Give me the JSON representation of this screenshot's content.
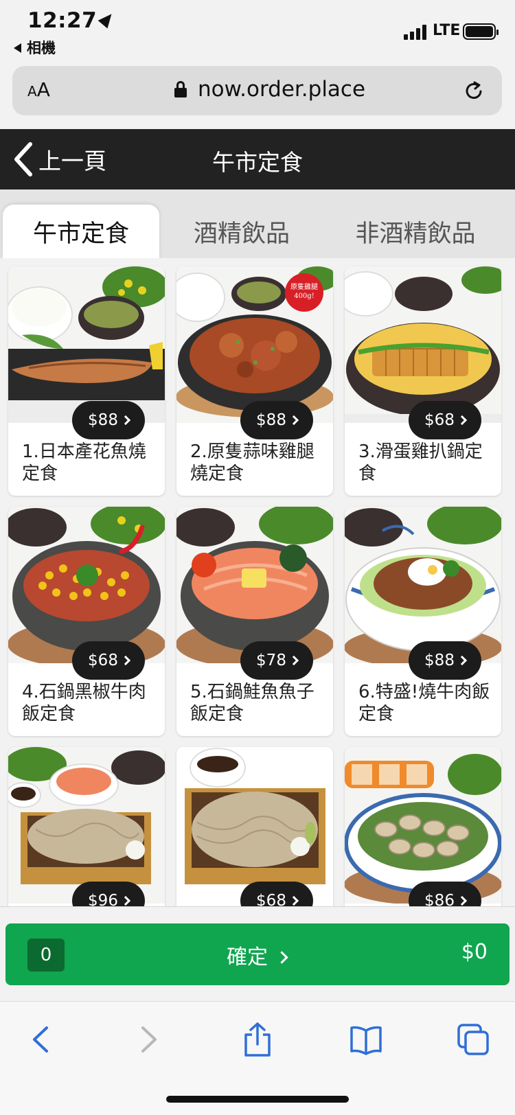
{
  "status_bar": {
    "time": "12:27",
    "back_app": "相機",
    "network": "LTE"
  },
  "browser": {
    "text_size_label": "AA",
    "url": "now.order.place"
  },
  "header": {
    "back_label": "上一頁",
    "title": "午市定食"
  },
  "tabs": [
    {
      "label": "午市定食",
      "active": true
    },
    {
      "label": "酒精飲品",
      "active": false
    },
    {
      "label": "非酒精飲品",
      "active": false
    }
  ],
  "menu_items": [
    {
      "name": "1.日本產花魚燒定食",
      "price": "$88",
      "badge": ""
    },
    {
      "name": "2.原隻蒜味雞腿燒定食",
      "price": "$88",
      "badge": "原隻雞腿 400g!"
    },
    {
      "name": "3.滑蛋雞扒鍋定食",
      "price": "$68",
      "badge": ""
    },
    {
      "name": "4.石鍋黑椒牛肉飯定食",
      "price": "$68",
      "badge": ""
    },
    {
      "name": "5.石鍋鮭魚魚子飯定食",
      "price": "$78",
      "badge": ""
    },
    {
      "name": "6.特盛!燒牛肉飯定食",
      "price": "$88",
      "badge": ""
    },
    {
      "name": "",
      "price": "$96",
      "badge": ""
    },
    {
      "name": "",
      "price": "$68",
      "badge": ""
    },
    {
      "name": "",
      "price": "$86",
      "badge": ""
    }
  ],
  "cart": {
    "count": "0",
    "confirm_label": "確定",
    "total": "$0"
  },
  "colors": {
    "header_bg": "#222222",
    "confirm_green": "#10a54f",
    "count_bg": "#0b6a2f",
    "tab_bar_bg": "#e4e4e4"
  }
}
